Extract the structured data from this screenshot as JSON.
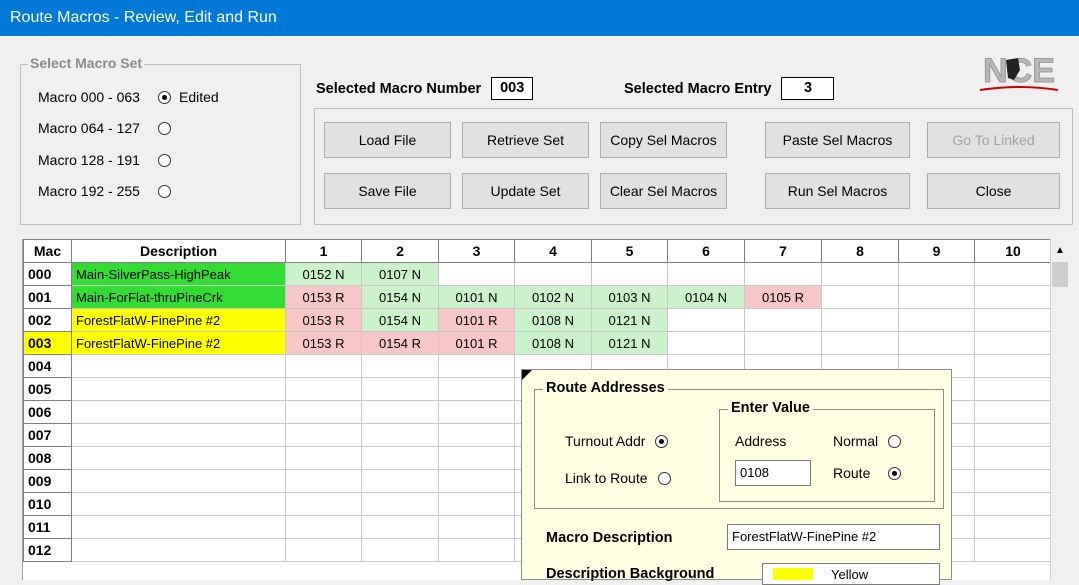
{
  "window": {
    "title": "Route Macros - Review, Edit and Run"
  },
  "macro_set": {
    "legend": "Select Macro Set",
    "options": [
      {
        "label": "Macro 000 - 063",
        "checked": true,
        "extra": "Edited"
      },
      {
        "label": "Macro 064 - 127",
        "checked": false,
        "extra": ""
      },
      {
        "label": "Macro 128 - 191",
        "checked": false,
        "extra": ""
      },
      {
        "label": "Macro 192 - 255",
        "checked": false,
        "extra": ""
      }
    ]
  },
  "selected": {
    "macro_number_label": "Selected Macro Number",
    "macro_number": "003",
    "macro_entry_label": "Selected Macro Entry",
    "macro_entry": "3"
  },
  "buttons": {
    "load_file": "Load File",
    "retrieve_set": "Retrieve Set",
    "copy_sel": "Copy Sel Macros",
    "paste_sel": "Paste Sel Macros",
    "go_linked": "Go To Linked",
    "save_file": "Save File",
    "update_set": "Update Set",
    "clear_sel": "Clear Sel Macros",
    "run_sel": "Run Sel Macros",
    "close": "Close"
  },
  "logo": {
    "text": "NCE"
  },
  "grid": {
    "headers": [
      "Mac",
      "Description",
      "1",
      "2",
      "3",
      "4",
      "5",
      "6",
      "7",
      "8",
      "9",
      "10"
    ],
    "rows": [
      {
        "mac": "000",
        "desc": "Main-SilverPass-HighPeak",
        "color": "green",
        "entries": [
          "0152 N",
          "0107 N"
        ]
      },
      {
        "mac": "001",
        "desc": "Main-ForFlat-thruPineCrk",
        "color": "green",
        "entries": [
          "0153 R",
          "0154 N",
          "0101 N",
          "0102 N",
          "0103 N",
          "0104 N",
          "0105 R"
        ]
      },
      {
        "mac": "002",
        "desc": "ForestFlatW-FinePine #2",
        "color": "yellow",
        "entries": [
          "0153 R",
          "0154 N",
          "0101 R",
          "0108 N",
          "0121 N"
        ]
      },
      {
        "mac": "003",
        "desc": "ForestFlatW-FinePine #2",
        "color": "yellow",
        "entries": [
          "0153 R",
          "0154 R",
          "0101 R",
          "0108 N",
          "0121 N"
        ],
        "selected": true
      },
      {
        "mac": "004",
        "desc": "",
        "entries": []
      },
      {
        "mac": "005",
        "desc": "",
        "entries": []
      },
      {
        "mac": "006",
        "desc": "",
        "entries": []
      },
      {
        "mac": "007",
        "desc": "",
        "entries": []
      },
      {
        "mac": "008",
        "desc": "",
        "entries": []
      },
      {
        "mac": "009",
        "desc": "",
        "entries": []
      },
      {
        "mac": "010",
        "desc": "",
        "entries": []
      },
      {
        "mac": "011",
        "desc": "",
        "entries": []
      },
      {
        "mac": "012",
        "desc": "",
        "entries": []
      }
    ]
  },
  "popup": {
    "route_legend": "Route Addresses",
    "turnout_addr": "Turnout Addr",
    "link_to_route": "Link to Route",
    "enter_value_legend": "Enter Value",
    "address_label": "Address",
    "normal_label": "Normal",
    "route_label": "Route",
    "address_value": "0108",
    "macro_desc_label": "Macro Description",
    "macro_desc_value": "ForestFlatW-FinePine #2",
    "desc_bg_label": "Description Background",
    "desc_bg_value": "Yellow"
  }
}
